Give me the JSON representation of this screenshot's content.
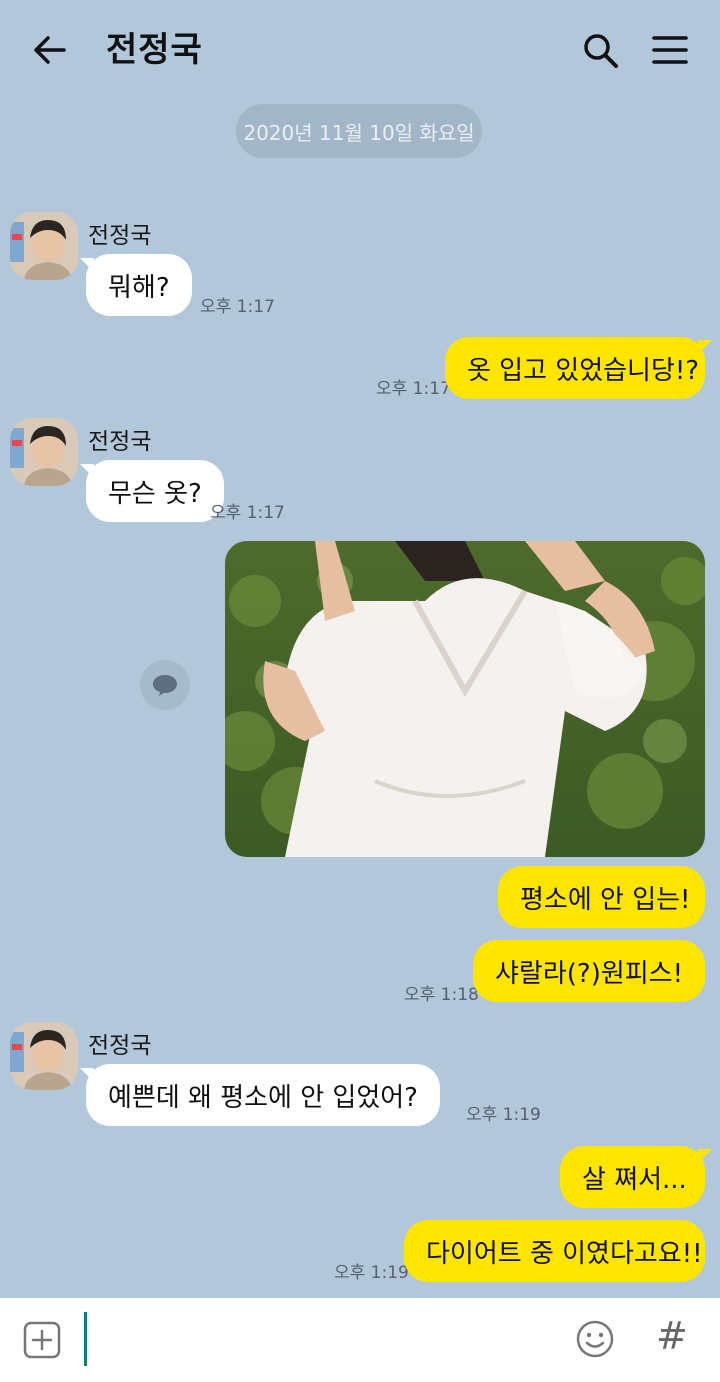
{
  "header": {
    "title": "전정국",
    "back_icon": "arrow-left-icon",
    "search_icon": "search-icon",
    "menu_icon": "hamburger-menu-icon"
  },
  "date_divider": "2020년 11월 10일 화요일",
  "colors": {
    "background": "#b2c7da",
    "outgoing_bubble": "#fee500",
    "incoming_bubble": "#ffffff"
  },
  "messages": [
    {
      "sender": "전정국",
      "text": "뭐해?",
      "time": "오후 1:17"
    },
    {
      "text": "옷 입고 있었습니당!?",
      "time": "오후 1:17"
    },
    {
      "sender": "전정국",
      "text": "무슨 옷?",
      "time": "오후 1:17"
    },
    {
      "text": "평소에 안 입는!"
    },
    {
      "text": "샤랄라(?)원피스!",
      "time": "오후 1:18"
    },
    {
      "sender": "전정국",
      "text": "예쁜데 왜 평소에 안 입었어?",
      "time": "오후 1:19"
    },
    {
      "text": "살 쪄서..."
    },
    {
      "text": "다이어트 중 이였다고요!!",
      "time": "오후 1:19"
    }
  ],
  "input_bar": {
    "plus_icon": "plus-square-icon",
    "emoji_icon": "emoji-icon",
    "hash_icon": "#",
    "value": ""
  }
}
